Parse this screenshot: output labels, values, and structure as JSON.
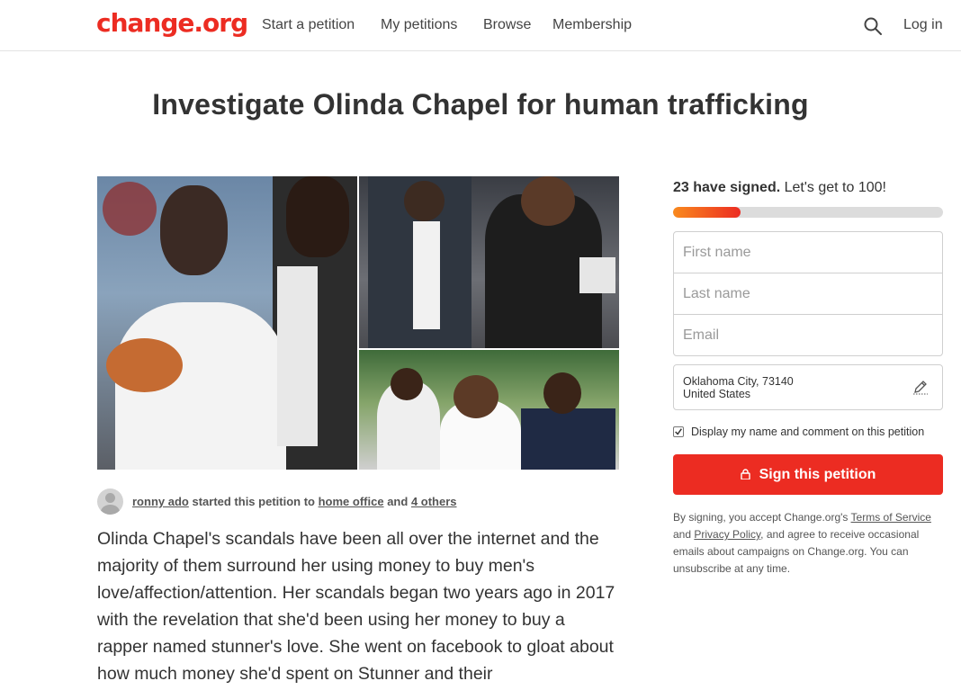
{
  "brand": {
    "logo": "change.org",
    "accent": "#ec2c22"
  },
  "nav": {
    "items": [
      {
        "label": "Start a petition"
      },
      {
        "label": "My petitions"
      },
      {
        "label": "Browse"
      },
      {
        "label": "Membership"
      }
    ],
    "search_icon": "search-icon",
    "login": "Log in"
  },
  "petition": {
    "title": "Investigate Olinda Chapel for human trafficking",
    "starter": {
      "name": "ronny ado",
      "text_started": "started this petition to",
      "target": "home office",
      "and": "and",
      "others": "4 others"
    },
    "body": "Olinda Chapel's scandals have been all over the internet and the majority of them surround her using money to buy men's love/affection/attention. Her scandals began two years ago in 2017 with the revelation that she'd been using her money to buy a rapper named stunner's love. She went on facebook to gloat about how much money she'd spent on Stunner and their"
  },
  "sign_panel": {
    "signed_count": "23 have signed.",
    "goal_text": "Let's get to 100!",
    "progress_fraction": 0.25,
    "first_name_placeholder": "First name",
    "last_name_placeholder": "Last name",
    "email_placeholder": "Email",
    "location_line1": "Oklahoma City, 73140",
    "location_line2": "United States",
    "display_checkbox_label": "Display my name and comment on this petition",
    "display_checked": true,
    "sign_button": "Sign this petition",
    "legal_1": "By signing, you accept Change.org's",
    "terms": "Terms of Service",
    "and": "and",
    "privacy": "Privacy Policy",
    "legal_2": ", and agree to receive occasional emails about campaigns on Change.org. You can unsubscribe at any time."
  }
}
